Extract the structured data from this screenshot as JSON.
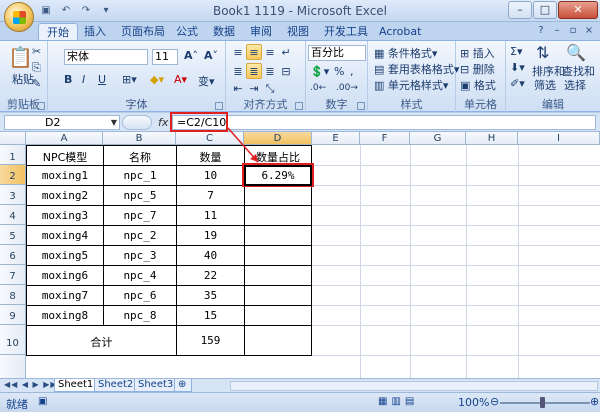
{
  "window": {
    "title": "Book1 1119 - Microsoft Excel"
  },
  "quick_access": [
    "save-icon",
    "undo-icon",
    "redo-icon",
    "customize-icon"
  ],
  "tabs": [
    "开始",
    "插入",
    "页面布局",
    "公式",
    "数据",
    "审阅",
    "视图",
    "开发工具",
    "Acrobat"
  ],
  "ribbon": {
    "clipboard": {
      "paste": "粘贴",
      "label": "剪贴板"
    },
    "font": {
      "name": "宋体",
      "size": "11",
      "bold": "B",
      "italic": "I",
      "underline": "U",
      "label": "字体"
    },
    "alignment": {
      "label": "对齐方式"
    },
    "number": {
      "format": "百分比",
      "label": "数字"
    },
    "styles": {
      "conditional": "条件格式",
      "table": "套用表格格式",
      "cell": "单元格样式",
      "label": "样式"
    },
    "cells": {
      "insert": "插入",
      "delete": "删除",
      "format": "格式",
      "label": "单元格"
    },
    "editing": {
      "sort": "排序和",
      "sort2": "筛选",
      "find": "查找和",
      "find2": "选择",
      "label": "编辑"
    }
  },
  "formula_bar": {
    "name_box": "D2",
    "fx": "fx",
    "formula": "=C2/C10"
  },
  "columns": [
    "A",
    "B",
    "C",
    "D",
    "E",
    "F",
    "G",
    "H",
    "I"
  ],
  "rows": [
    "1",
    "2",
    "3",
    "4",
    "5",
    "6",
    "7",
    "8",
    "9",
    "10"
  ],
  "table": {
    "headers": [
      "NPC模型",
      "名称",
      "数量",
      "数量占比"
    ],
    "rows": [
      [
        "moxing1",
        "npc_1",
        "10",
        "6.29%"
      ],
      [
        "moxing2",
        "npc_5",
        "7",
        ""
      ],
      [
        "moxing3",
        "npc_7",
        "11",
        ""
      ],
      [
        "moxing4",
        "npc_2",
        "19",
        ""
      ],
      [
        "moxing5",
        "npc_3",
        "40",
        ""
      ],
      [
        "moxing6",
        "npc_4",
        "22",
        ""
      ],
      [
        "moxing7",
        "npc_6",
        "35",
        ""
      ],
      [
        "moxing8",
        "npc_8",
        "15",
        ""
      ]
    ],
    "total_label": "合计",
    "total_value": "159"
  },
  "sheets": [
    "Sheet1",
    "Sheet2",
    "Sheet3"
  ],
  "status": {
    "mode": "就绪",
    "zoom": "100%"
  },
  "colors": {
    "highlight": "#e02020",
    "ribbon_accent": "#15428b"
  }
}
